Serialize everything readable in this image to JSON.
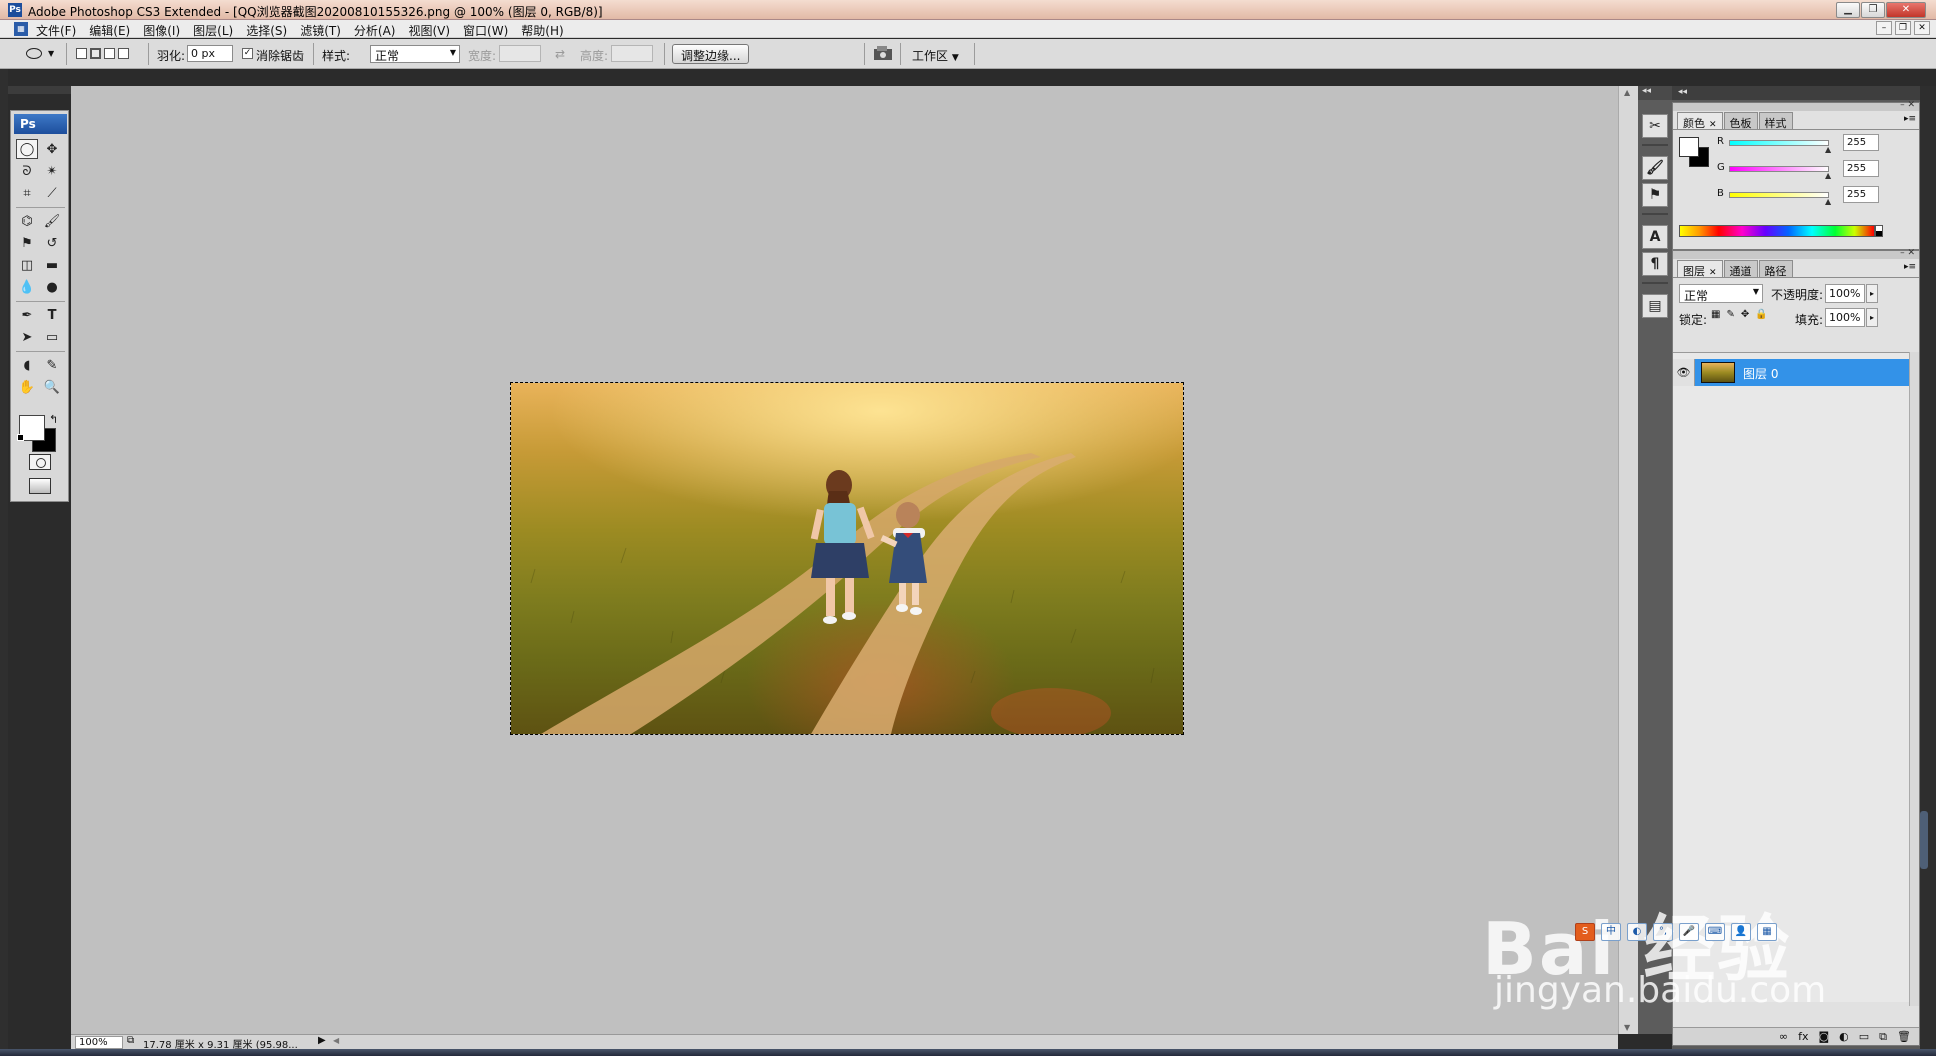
{
  "window": {
    "title": "Adobe Photoshop CS3 Extended - [QQ浏览器截图20200810155326.png @ 100% (图层 0, RGB/8)]",
    "app_icon": "Ps"
  },
  "menu": {
    "items": [
      "文件(F)",
      "编辑(E)",
      "图像(I)",
      "图层(L)",
      "选择(S)",
      "滤镜(T)",
      "分析(A)",
      "视图(V)",
      "窗口(W)",
      "帮助(H)"
    ]
  },
  "options": {
    "feather_label": "羽化:",
    "feather_value": "0 px",
    "antialias_label": "消除锯齿",
    "antialias_checked": true,
    "style_label": "样式:",
    "style_value": "正常",
    "width_label": "宽度:",
    "height_label": "高度:",
    "refine_edge_button": "调整边缘...",
    "workspace_label": "工作区"
  },
  "tools": {
    "badge": "Ps",
    "active_tool": "elliptical-marquee",
    "foreground_color": "#ffffff",
    "background_color": "#000000"
  },
  "status": {
    "zoom": "100%",
    "doc_info": "17.78 厘米 x 9.31 厘米 (95.98..."
  },
  "color_panel": {
    "tabs": [
      "颜色",
      "色板",
      "样式"
    ],
    "r_label": "R",
    "r_value": "255",
    "g_label": "G",
    "g_value": "255",
    "b_label": "B",
    "b_value": "255"
  },
  "layers_panel": {
    "tabs": [
      "图层",
      "通道",
      "路径"
    ],
    "blend_mode": "正常",
    "opacity_label": "不透明度:",
    "opacity_value": "100%",
    "lock_label": "锁定:",
    "fill_label": "填充:",
    "fill_value": "100%",
    "layers": [
      {
        "name": "图层 0",
        "visible": true,
        "selected": true
      }
    ]
  },
  "watermark": {
    "brand": "Bai 经验",
    "url": "jingyan.baidu.com"
  },
  "colors": {
    "selection_blue": "#3392e8",
    "canvas_gray": "#c0c0c0",
    "panel_bg": "#e1e1e1"
  }
}
